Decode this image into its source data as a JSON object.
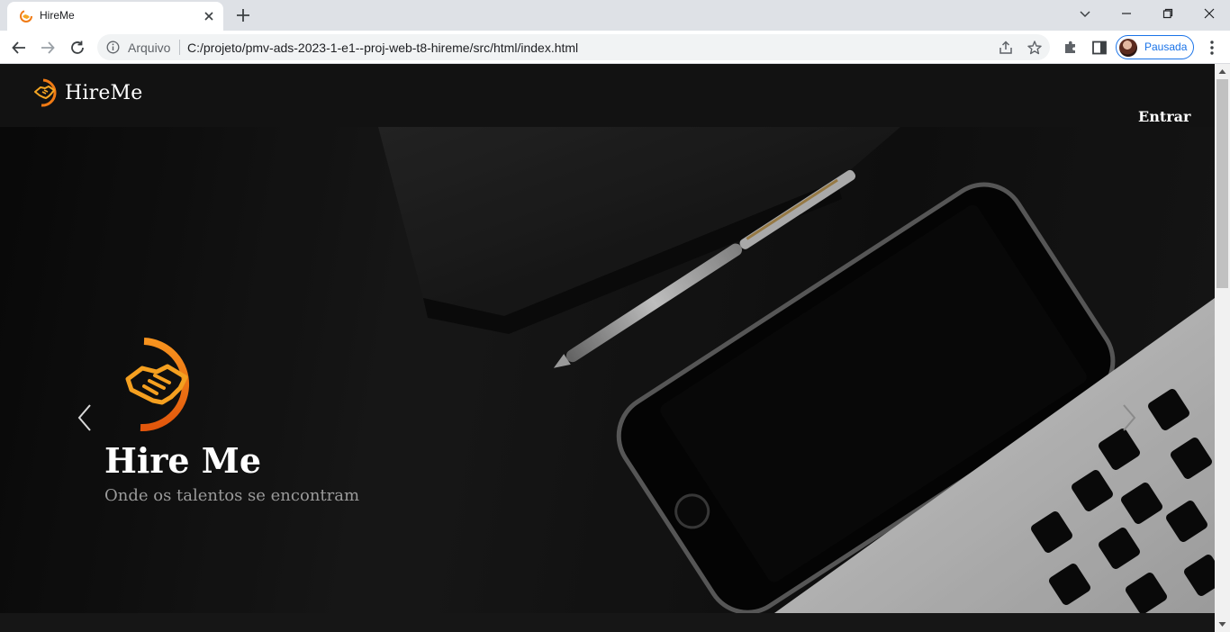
{
  "browser": {
    "tab_title": "HireMe",
    "address_label": "Arquivo",
    "url": "C:/projeto/pmv-ads-2023-1-e1--proj-web-t8-hireme/src/html/index.html",
    "profile_label": "Pausada"
  },
  "site": {
    "brand_name": "HireMe",
    "login_label": "Entrar",
    "accent_color": "#f07a14"
  },
  "hero": {
    "title": "Hire Me",
    "subtitle": "Onde os talentos se encontram"
  }
}
